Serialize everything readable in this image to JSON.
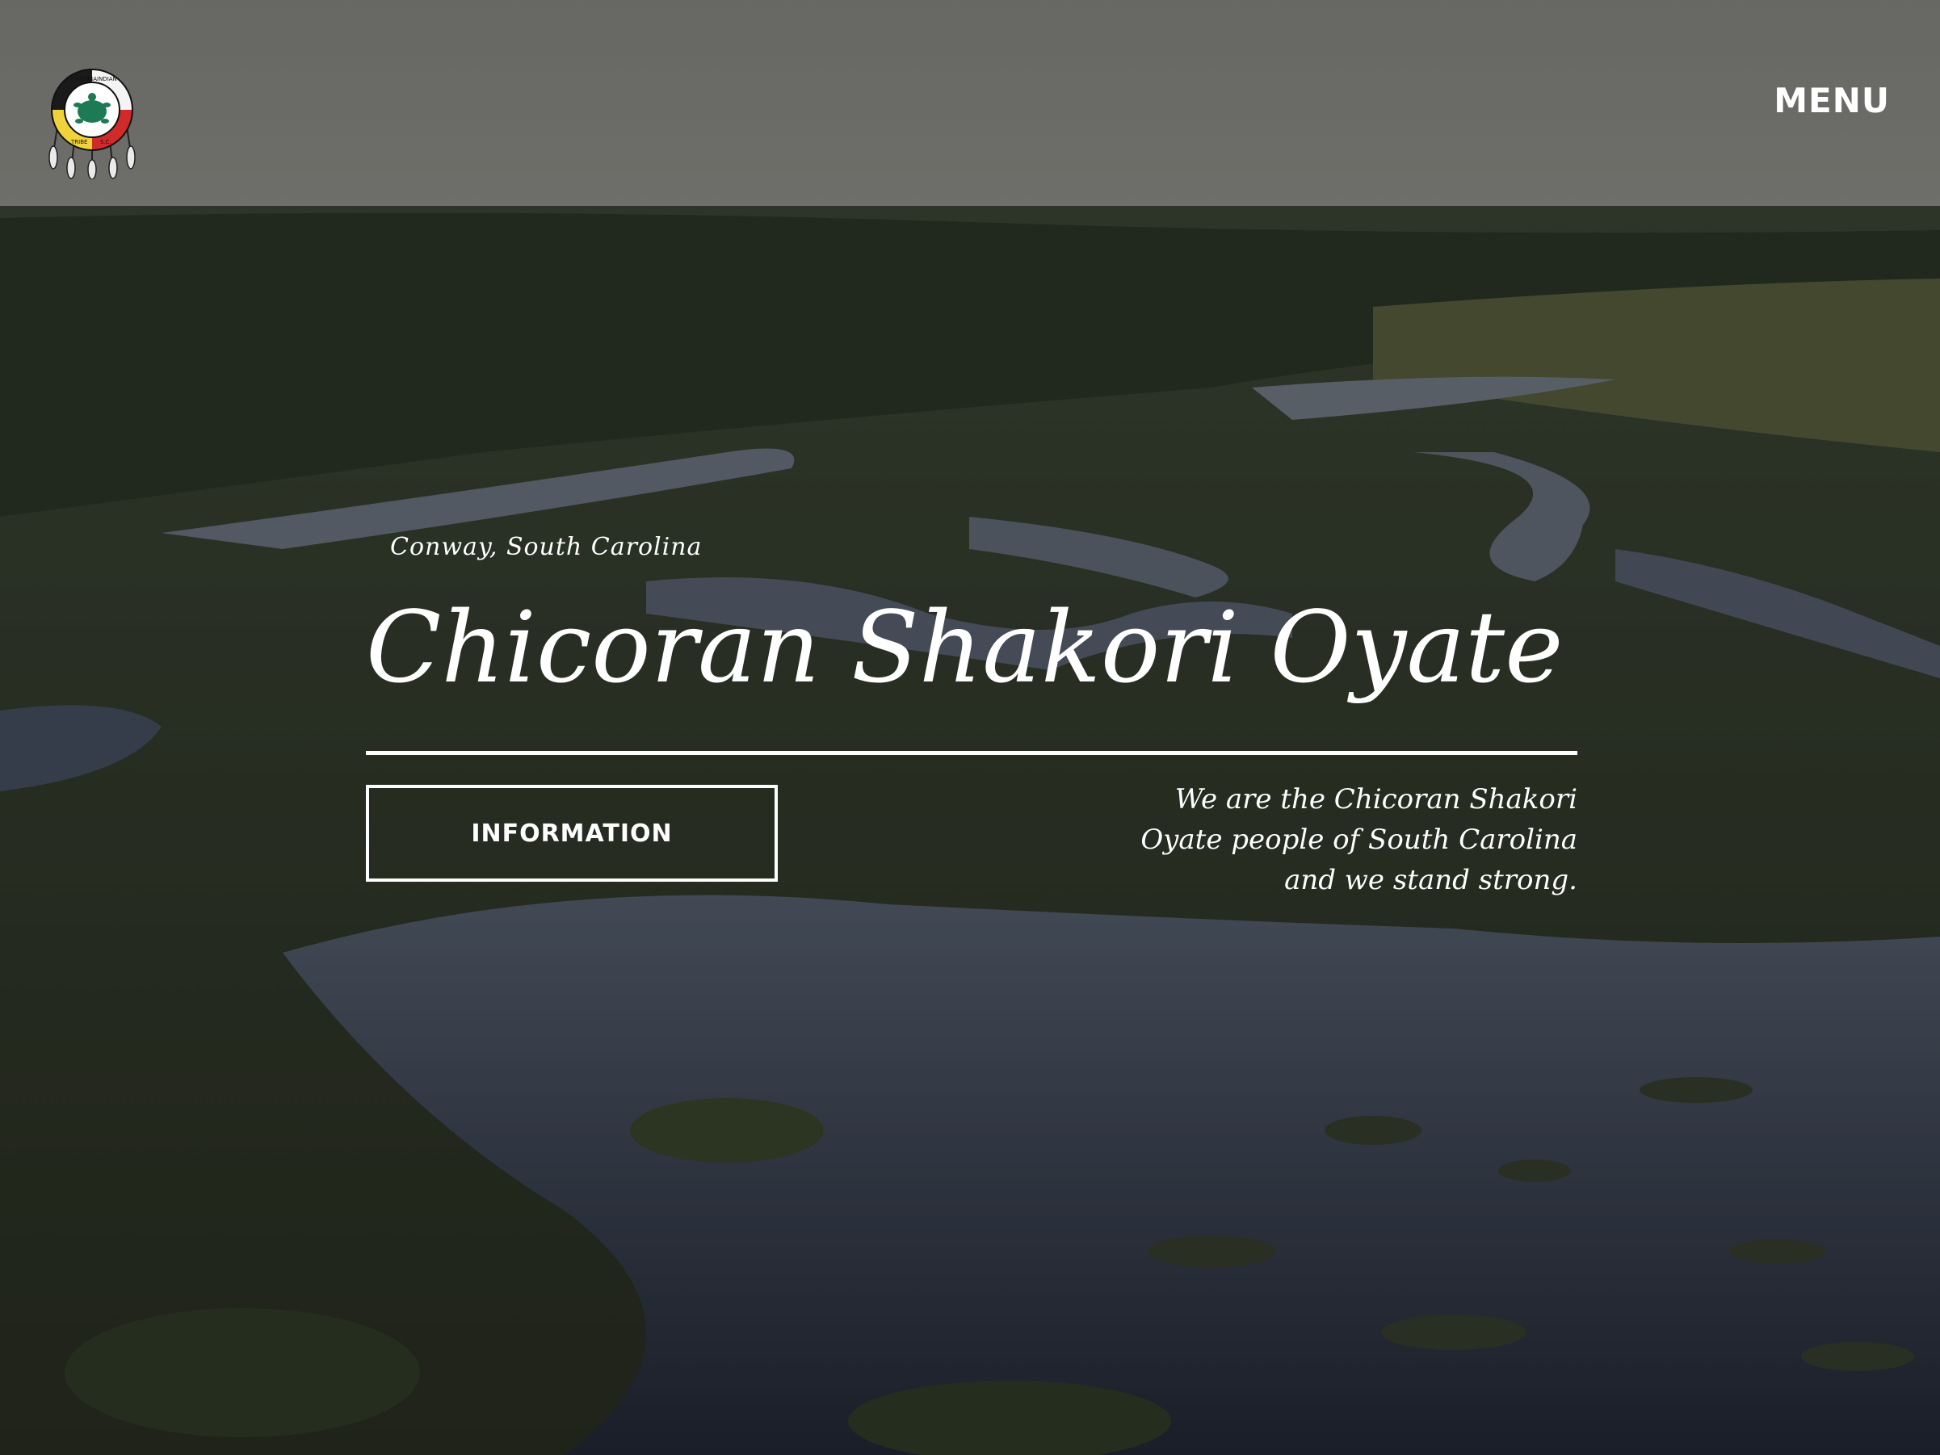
{
  "header": {
    "logo_icon": "chicora-indian-tribe-seal-icon",
    "logo_text": [
      "CHICORA",
      "INDIAN",
      "TRIBE",
      "S.C."
    ],
    "menu_label": "MENU"
  },
  "hero": {
    "location": "Conway, South Carolina",
    "title": "Chicoran Shakori Oyate",
    "button_label": "INFORMATION",
    "tagline_lines": [
      "We are the Chicoran Shakori",
      "Oyate people of South Carolina",
      "and we stand strong."
    ]
  },
  "colors": {
    "text": "#ffffff",
    "sky": "#8a8a86",
    "marsh": "#4a5535",
    "water": "#2a3140"
  }
}
